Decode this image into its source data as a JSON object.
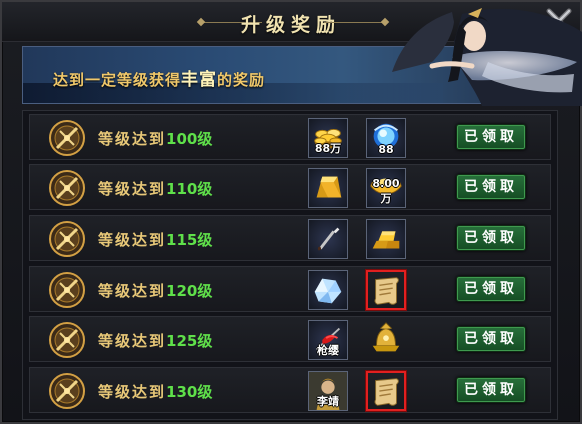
{
  "dialog": {
    "title": "升级奖励",
    "banner": {
      "text_prefix": "达到一定等级获得",
      "text_highlight": "丰富",
      "text_suffix": "的奖励"
    }
  },
  "rows": [
    {
      "label_prefix": "等级达到",
      "level": "100",
      "label_suffix": "级",
      "reward1": {
        "icon": "gold-coins-icon",
        "count": "88万"
      },
      "reward2": {
        "icon": "blue-orb-icon",
        "count": "88"
      },
      "button": "已领取"
    },
    {
      "label_prefix": "等级达到",
      "level": "110",
      "label_suffix": "级",
      "reward1": {
        "icon": "gold-bar-icon",
        "count": ""
      },
      "reward2": {
        "icon": "gold-ingot-icon",
        "count": "8.00万"
      },
      "button": "已领取"
    },
    {
      "label_prefix": "等级达到",
      "level": "115",
      "label_suffix": "级",
      "reward1": {
        "icon": "brush-icon",
        "count": ""
      },
      "reward2": {
        "icon": "gold-bars-stack-icon",
        "count": ""
      },
      "button": "已领取"
    },
    {
      "label_prefix": "等级达到",
      "level": "120",
      "label_suffix": "级",
      "reward1": {
        "icon": "crystal-icon",
        "count": ""
      },
      "reward2": {
        "icon": "scroll-icon",
        "count": ""
      },
      "button": "已领取"
    },
    {
      "label_prefix": "等级达到",
      "level": "125",
      "label_suffix": "级",
      "reward1": {
        "icon": "spear-tassel-icon",
        "count": "枪缨"
      },
      "reward2": {
        "icon": "golden-helmet-icon",
        "count": ""
      },
      "button": "已领取"
    },
    {
      "label_prefix": "等级达到",
      "level": "130",
      "label_suffix": "级",
      "reward1": {
        "icon": "general-portrait-icon",
        "count": "李靖"
      },
      "reward2": {
        "icon": "scroll-icon",
        "count": ""
      },
      "button": "已领取"
    }
  ]
}
